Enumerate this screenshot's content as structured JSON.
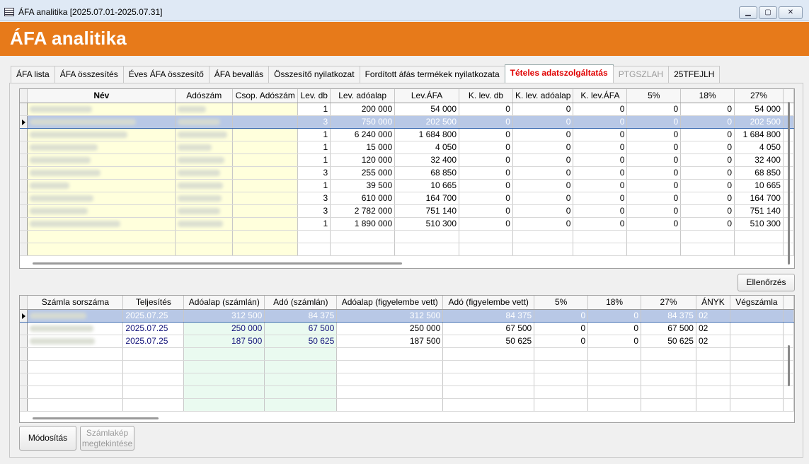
{
  "window": {
    "title": "ÁFA analitika [2025.07.01-2025.07.31]"
  },
  "header": {
    "title": "ÁFA analitika"
  },
  "tabs": [
    {
      "label": "ÁFA lista"
    },
    {
      "label": "ÁFA összesítés"
    },
    {
      "label": "Éves ÁFA összesítő"
    },
    {
      "label": "ÁFA bevallás"
    },
    {
      "label": "Összesítő nyilatkozat"
    },
    {
      "label": "Fordított áfás termékek nyilatkozata"
    },
    {
      "label": "Tételes adatszolgáltatás"
    },
    {
      "label": "PTGSZLAH"
    },
    {
      "label": "25TFEJLH"
    }
  ],
  "top_grid": {
    "columns": [
      "Név",
      "Adószám",
      "Csop. Adószám",
      "Lev. db",
      "Lev. adóalap",
      "Lev.ÁFA",
      "K. lev. db",
      "K. lev. adóalap",
      "K. lev.ÁFA",
      "5%",
      "18%",
      "27%"
    ],
    "rows": [
      [
        "1",
        "200 000",
        "54 000",
        "0",
        "0",
        "0",
        "0",
        "0",
        "54 000"
      ],
      [
        "3",
        "750 000",
        "202 500",
        "0",
        "0",
        "0",
        "0",
        "0",
        "202 500"
      ],
      [
        "1",
        "6 240 000",
        "1 684 800",
        "0",
        "0",
        "0",
        "0",
        "0",
        "1 684 800"
      ],
      [
        "1",
        "15 000",
        "4 050",
        "0",
        "0",
        "0",
        "0",
        "0",
        "4 050"
      ],
      [
        "1",
        "120 000",
        "32 400",
        "0",
        "0",
        "0",
        "0",
        "0",
        "32 400"
      ],
      [
        "3",
        "255 000",
        "68 850",
        "0",
        "0",
        "0",
        "0",
        "0",
        "68 850"
      ],
      [
        "1",
        "39 500",
        "10 665",
        "0",
        "0",
        "0",
        "0",
        "0",
        "10 665"
      ],
      [
        "3",
        "610 000",
        "164 700",
        "0",
        "0",
        "0",
        "0",
        "0",
        "164 700"
      ],
      [
        "3",
        "2 782 000",
        "751 140",
        "0",
        "0",
        "0",
        "0",
        "0",
        "751 140"
      ],
      [
        "1",
        "1 890 000",
        "510 300",
        "0",
        "0",
        "0",
        "0",
        "0",
        "510 300"
      ]
    ]
  },
  "check_button": "Ellenőrzés",
  "bottom_grid": {
    "columns": [
      "Számla sorszáma",
      "Teljesítés",
      "Adóalap (számlán)",
      "Adó (számlán)",
      "Adóalap (figyelembe vett)",
      "Adó (figyelembe vett)",
      "5%",
      "18%",
      "27%",
      "ÁNYK",
      "Végszámla"
    ],
    "rows": [
      [
        "2025.07.25",
        "312 500",
        "84 375",
        "312 500",
        "84 375",
        "0",
        "0",
        "84 375",
        "02",
        ""
      ],
      [
        "2025.07.25",
        "250 000",
        "67 500",
        "250 000",
        "67 500",
        "0",
        "0",
        "67 500",
        "02",
        ""
      ],
      [
        "2025.07.25",
        "187 500",
        "50 625",
        "187 500",
        "50 625",
        "0",
        "0",
        "50 625",
        "02",
        ""
      ]
    ]
  },
  "buttons": {
    "modify": "Módosítás",
    "invoice_view_line1": "Számlakép",
    "invoice_view_line2": "megtekintése"
  }
}
